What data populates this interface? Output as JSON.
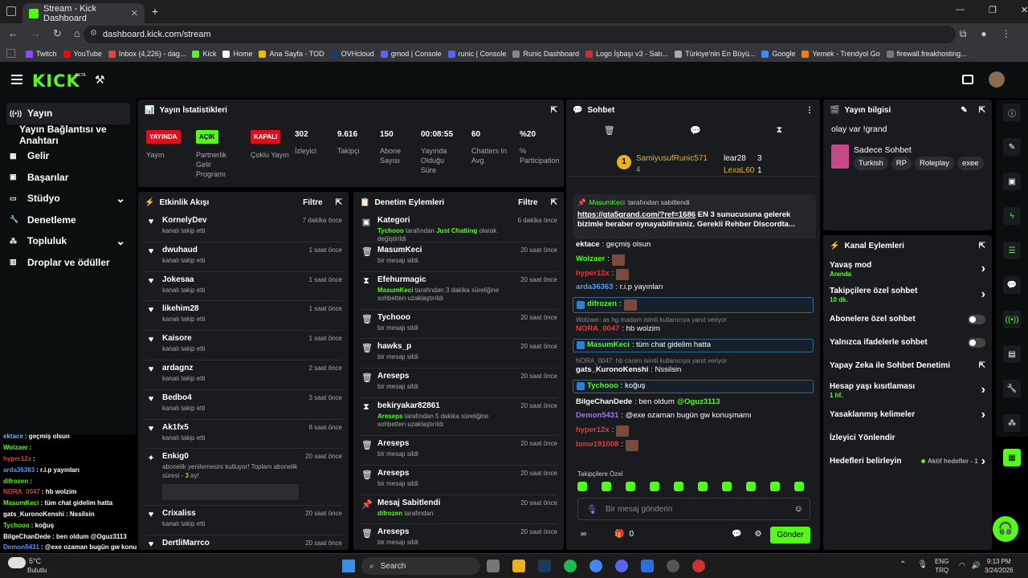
{
  "browser": {
    "tab_title": "Stream - Kick Dashboard",
    "url": "dashboard.kick.com/stream",
    "bookmarks": [
      {
        "label": "Twitch",
        "color": "#9146ff"
      },
      {
        "label": "YouTube",
        "color": "#ff0000"
      },
      {
        "label": "Inbox (4,226) - dag...",
        "color": "#ea4335"
      },
      {
        "label": "Kick",
        "color": "#53fc18"
      },
      {
        "label": "Home",
        "color": "#ffffff"
      },
      {
        "label": "Ana Sayfa - TOD",
        "color": "#e8c000"
      },
      {
        "label": "OVHcloud",
        "color": "#123f6d"
      },
      {
        "label": "gmod | Console",
        "color": "#5865f2"
      },
      {
        "label": "runic | Console",
        "color": "#5865f2"
      },
      {
        "label": "Runic Dashboard",
        "color": "#888888"
      },
      {
        "label": "Logo İşbaşı v3 - Satı...",
        "color": "#d32f2f"
      },
      {
        "label": "Türkiye'nin En Büyü...",
        "color": "#aaaaaa"
      },
      {
        "label": "Google",
        "color": "#4285f4"
      },
      {
        "label": "Yemek - Trendyol Go",
        "color": "#f27a1a"
      },
      {
        "label": "firewall.freakhosting...",
        "color": "#777777"
      }
    ]
  },
  "header": {
    "logo": "KICK",
    "beta": "BETA"
  },
  "sidebar": {
    "items": [
      {
        "label": "Yayın",
        "icon": "broadcast-icon"
      },
      {
        "label": "Yayın Bağlantısı ve Anahtarı",
        "icon": ""
      },
      {
        "label": "Gelir",
        "icon": "revenue-icon"
      },
      {
        "label": "Başarılar",
        "icon": "achievements-icon"
      },
      {
        "label": "Stüdyo",
        "icon": "studio-icon"
      },
      {
        "label": "Denetleme",
        "icon": "wrench-icon"
      },
      {
        "label": "Topluluk",
        "icon": "community-icon"
      },
      {
        "label": "Droplar ve ödüller",
        "icon": "drops-icon"
      }
    ]
  },
  "stats": {
    "title": "Yayın İstatistikleri",
    "badges": [
      {
        "value": "YAYINDA",
        "label": "Yayın",
        "color": "#e00d1a",
        "text": "#fff"
      },
      {
        "value": "AÇIK",
        "label": "Partnerlik Gelir Programı",
        "color": "#53fc18",
        "text": "#000"
      },
      {
        "value": "KAPALI",
        "label": "Çoklu Yayın",
        "color": "#e00d1a",
        "text": "#fff"
      }
    ],
    "numbers": [
      {
        "value": "302",
        "label": "İzleyici"
      },
      {
        "value": "9.616",
        "label": "Takipçi"
      },
      {
        "value": "150",
        "label": "Abone Sayısı"
      },
      {
        "value": "00:08:55",
        "label": "Yayında Olduğu Süre"
      },
      {
        "value": "60",
        "label": "Chatters In Avg."
      },
      {
        "value": "%20",
        "label": "% Participation"
      }
    ]
  },
  "activity": {
    "title": "Etkinlik Akışı",
    "filter": "Filtre",
    "items": [
      {
        "name": "KornelyDev",
        "sub": "kanalı takip etti",
        "time": "7 dakika önce"
      },
      {
        "name": "dwuhaud",
        "sub": "kanalı takip etti",
        "time": "1 saat önce"
      },
      {
        "name": "Jokesaa",
        "sub": "kanalı takip etti",
        "time": "1 saat önce"
      },
      {
        "name": "likehim28",
        "sub": "kanalı takip etti",
        "time": "1 saat önce"
      },
      {
        "name": "Kaisore",
        "sub": "kanalı takip etti",
        "time": "1 saat önce"
      },
      {
        "name": "ardagnz",
        "sub": "kanalı takip etti",
        "time": "2 saat önce"
      },
      {
        "name": "Bedbo4",
        "sub": "kanalı takip etti",
        "time": "3 saat önce"
      },
      {
        "name": "Ak1fx5",
        "sub": "kanalı takip etti",
        "time": "8 saat önce"
      }
    ],
    "resub": {
      "name": "Enkig0",
      "time": "20 saat önce",
      "sub": "abonelik yenilemesini kutluyor! Toplam abonelik süresi -",
      "months": "3",
      "suffix": "ay!"
    },
    "more": [
      {
        "name": "Crixaliss",
        "sub": "kanalı takip etti",
        "time": "20 saat önce"
      },
      {
        "name": "DertliMarrco",
        "sub": "",
        "time": "20 saat önce"
      }
    ]
  },
  "moderation": {
    "title": "Denetim Eylemleri",
    "filter": "Filtre",
    "items": [
      {
        "name": "Kategori",
        "icon": "category-icon",
        "sub_pre": "Tychooo",
        "sub": " tarafından ",
        "sub_hl": "Just Chatting",
        "sub_post": " olarak değiştirildi",
        "time": "6 dakika önce"
      },
      {
        "name": "MasumKeci",
        "icon": "trash-icon",
        "sub": "bir mesajı sildi",
        "time": "20 saat önce"
      },
      {
        "name": "Efehurmagic",
        "icon": "hourglass-icon",
        "sub_pre": "MasumKeci",
        "sub": " tarafından 3 dakika süreliğine sohbetten uzaklaştırıldı",
        "time": "20 saat önce"
      },
      {
        "name": "Tychooo",
        "icon": "trash-icon",
        "sub": "bir mesajı sildi",
        "time": "20 saat önce"
      },
      {
        "name": "hawks_p",
        "icon": "trash-icon",
        "sub": "bir mesajı sildi",
        "time": "20 saat önce"
      },
      {
        "name": "Areseps",
        "icon": "trash-icon",
        "sub": "bir mesajı sildi",
        "time": "20 saat önce"
      },
      {
        "name": "bekiryakar82861",
        "icon": "hourglass-icon",
        "sub_pre": "Areseps",
        "sub": " tarafından 5 dakika süreliğine sohbetten uzaklaştırıldı",
        "time": "20 saat önce"
      },
      {
        "name": "Areseps",
        "icon": "trash-icon",
        "sub": "bir mesajı sildi",
        "time": "20 saat önce"
      },
      {
        "name": "Areseps",
        "icon": "trash-icon",
        "sub": "bir mesajı sildi",
        "time": "20 saat önce"
      },
      {
        "name": "Mesaj Sabitlendi",
        "icon": "pin-icon",
        "sub_pre": "difrozen",
        "sub": " tarafından",
        "time": "20 saat önce"
      },
      {
        "name": "Areseps",
        "icon": "trash-icon",
        "sub": "bir mesajı sildi",
        "time": "20 saat önce"
      }
    ]
  },
  "chat": {
    "title": "Sohbet",
    "leaders": {
      "first": "SamiyusufRunic571",
      "first_sub": "4",
      "second": "lear28",
      "second_val": "3",
      "third": "LexaL60",
      "third_val": "1",
      "rank": "1"
    },
    "pinned": {
      "by": "MasumKeci",
      "by_suffix": "tarafından sabitlendi",
      "link": "https://gta5grand.com/?ref=1686",
      "text": " EN 3 sunucusuna gelerek bizimle beraber oynayabilirsiniz. Gerekli Rehber Discordta..."
    },
    "messages": [
      {
        "user": "ektace",
        "color": "#ffffff",
        "text": ": geçmiş olsun",
        "reply": ""
      },
      {
        "user": "Wolzaer",
        "color": "#53fc18",
        "text": ":",
        "reply": "",
        "emote": true
      },
      {
        "user": "hyper12x",
        "color": "#e23b3b",
        "text": ":",
        "reply": "",
        "emote": true
      },
      {
        "user": "arda36363",
        "color": "#4f9bff",
        "text": ": r.i.p yayınları",
        "reply": ""
      },
      {
        "user": "difrozen",
        "color": "#53fc18",
        "text": ":",
        "reply": "",
        "emote": true,
        "hl": true
      },
      {
        "user": "NORA_0047",
        "color": "#e23b3b",
        "text": ": hb wolzim",
        "reply": "Wolzaer: as hg madam isimli kullanıcıya yanıt veriyor"
      },
      {
        "user": "MasumKeci",
        "color": "#53fc18",
        "text": ": tüm chat gidelim hatta",
        "reply": "",
        "hl": true
      },
      {
        "user": "gats_KuronoKenshi",
        "color": "#ffffff",
        "text": ": Nssilsin",
        "reply": "NORA_0047: hb canim isimli kullanıcıya yanıt veriyor"
      },
      {
        "user": "Tychooo",
        "color": "#53fc18",
        "text": ": koğuş",
        "reply": "",
        "hl": true
      },
      {
        "user": "BilgeChanDede",
        "color": "#ffffff",
        "text": ": ben oldum ",
        "mention": "@Oguz3113",
        "reply": ""
      },
      {
        "user": "Demon5431",
        "color": "#a970ff",
        "text": ": @exe ozaman bugün gw konuşmamı",
        "reply": ""
      },
      {
        "user": "hyper12x",
        "color": "#e23b3b",
        "text": ":",
        "reply": "",
        "emote": true
      },
      {
        "user": "bmw191008",
        "color": "#e23b3b",
        "text": ":",
        "reply": "",
        "emote": true
      }
    ],
    "emote_label": "Takipçilere Özel",
    "input_placeholder": "Bir mesaj gönderin",
    "points": "0",
    "send": "Gönder"
  },
  "info": {
    "title": "Yayın bilgisi",
    "stream_title": "olay var !grand",
    "category": "Sadece Sohbet",
    "tags": [
      "Turkish",
      "RP",
      "Roleplay",
      "exee"
    ]
  },
  "channel_actions": {
    "title": "Kanal Eylemleri",
    "items": [
      {
        "label": "Yavaş mod",
        "sub": "Anında",
        "type": "arrow"
      },
      {
        "label": "Takipçilere özel sohbet",
        "sub": "10 dk.",
        "type": "arrow"
      },
      {
        "label": "Abonelere özel sohbet",
        "sub": "",
        "type": "toggle"
      },
      {
        "label": "Yalnızca ifadelerle sohbet",
        "sub": "",
        "type": "toggle"
      },
      {
        "label": "Yapay Zeka ile Sohbet Denetimi",
        "sub": "",
        "type": "ext"
      },
      {
        "label": "Hesap yaşı kısıtlaması",
        "sub": "1 hf.",
        "type": "arrow"
      },
      {
        "label": "Yasaklanmış kelimeler",
        "sub": "",
        "type": "arrow"
      },
      {
        "label": "İzleyici Yönlendir",
        "sub": "",
        "type": "none"
      },
      {
        "label": "Hedefleri belirleyin",
        "sub": "",
        "type": "goal",
        "extra": "Aktif hedefler - 1"
      }
    ]
  },
  "overlay_chat": [
    {
      "user": "ektace",
      "color": "#6fb6ff",
      "text": ": geçmiş olsun"
    },
    {
      "user": "Wolzaer",
      "color": "#53fc18",
      "text": ":"
    },
    {
      "user": "hyper12x",
      "color": "#e23b3b",
      "text": ":"
    },
    {
      "user": "arda36363",
      "color": "#4f9bff",
      "text": ": r.i.p yayınları"
    },
    {
      "user": "difrozen",
      "color": "#53fc18",
      "text": ":"
    },
    {
      "user": "NORA_0047",
      "color": "#e23b3b",
      "text": ": hb wolzim"
    },
    {
      "user": "MasumKeci",
      "color": "#53fc18",
      "text": ": tüm chat gidelim hatta"
    },
    {
      "user": "gats_KuronoKenshi",
      "color": "#ffffff",
      "text": ": Nssilsin"
    },
    {
      "user": "Tychooo",
      "color": "#53fc18",
      "text": ": koğuş"
    },
    {
      "user": "BilgeChanDede",
      "color": "#ffffff",
      "text": ": ben oldum @Oguz3113"
    },
    {
      "user": "Demon5431",
      "color": "#4f9bff",
      "text": ": @exe ozaman bugün gw konuşmamı"
    }
  ],
  "taskbar": {
    "weather": "Bulutlu",
    "temp": "5°C",
    "search": "Search",
    "lang1": "ENG",
    "lang2": "TRQ",
    "time": "9:13 PM",
    "date": "3/24/2026"
  }
}
